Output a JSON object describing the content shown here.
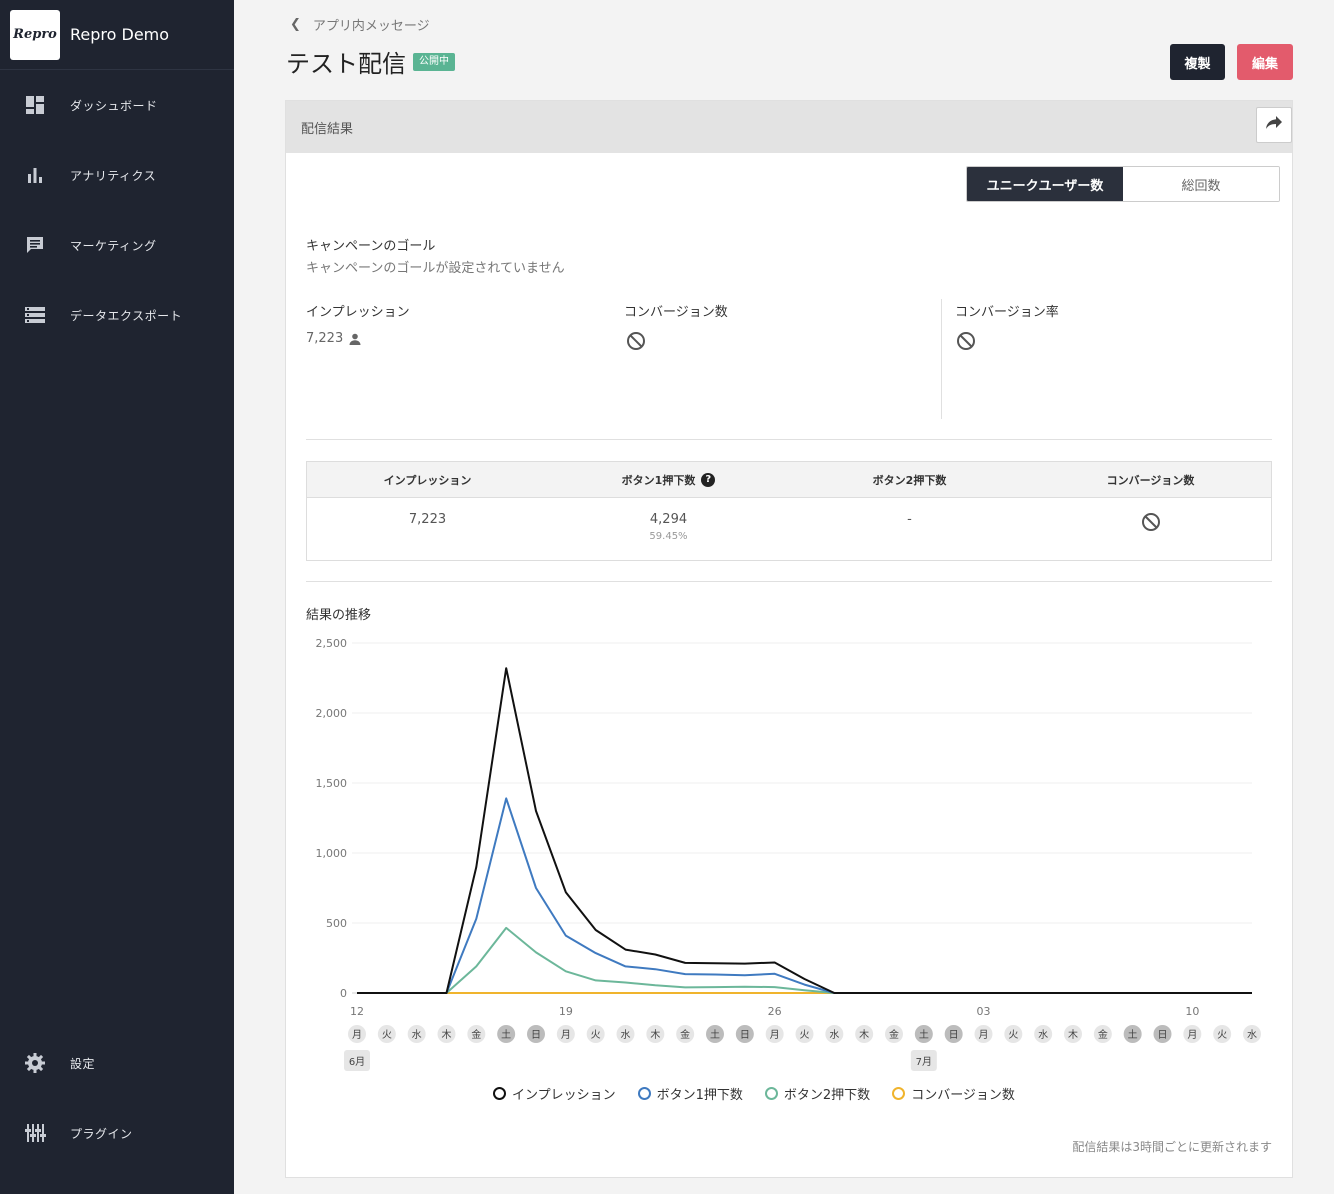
{
  "brand": {
    "logo_text": "Repro",
    "name": "Repro Demo"
  },
  "sidebar": {
    "items": [
      {
        "label": "ダッシュボード",
        "icon": "dashboard-icon"
      },
      {
        "label": "アナリティクス",
        "icon": "bar-chart-icon"
      },
      {
        "label": "マーケティング",
        "icon": "message-icon"
      },
      {
        "label": "データエクスポート",
        "icon": "storage-icon"
      }
    ],
    "bottom_items": [
      {
        "label": "設定",
        "icon": "gear-icon"
      },
      {
        "label": "プラグイン",
        "icon": "plugin-icon"
      }
    ]
  },
  "header": {
    "breadcrumb": "アプリ内メッセージ",
    "title": "テスト配信",
    "status": "公開中",
    "duplicate_label": "複製",
    "edit_label": "編集"
  },
  "card": {
    "title": "配信結果",
    "toggle": {
      "active": "ユニークユーザー数",
      "inactive": "総回数"
    },
    "goal_title": "キャンペーンのゴール",
    "goal_sub": "キャンペーンのゴールが設定されていません",
    "metrics": {
      "impression_label": "インプレッション",
      "impression_value": "7,223",
      "conversion_label": "コンバージョン数",
      "conversion_rate_label": "コンバージョン率"
    },
    "table": {
      "headers": [
        "インプレッション",
        "ボタン1押下数",
        "ボタン2押下数",
        "コンバージョン数"
      ],
      "help_mark": "?",
      "values": [
        "7,223",
        "4,294",
        "-"
      ],
      "button1_rate": "59.45%"
    },
    "chart_title": "結果の推移",
    "update_note": "配信結果は3時間ごとに更新されます"
  },
  "colors": {
    "sidebar_bg": "#1f2430",
    "badge": "#5ab493",
    "edit_button": "#e35b6c",
    "series_impression": "#111111",
    "series_button1": "#3f7ac0",
    "series_button2": "#6cb79a",
    "series_conversion": "#f0b42d"
  },
  "chart_data": {
    "type": "line",
    "x": [
      "06-12",
      "06-13",
      "06-14",
      "06-15",
      "06-16",
      "06-17",
      "06-18",
      "06-19",
      "06-20",
      "06-21",
      "06-22",
      "06-23",
      "06-24",
      "06-25",
      "06-26",
      "06-27",
      "06-28",
      "06-29",
      "06-30",
      "07-01",
      "07-02",
      "07-03",
      "07-04",
      "07-05",
      "07-06",
      "07-07",
      "07-08",
      "07-09",
      "07-10",
      "07-11",
      "07-12"
    ],
    "series": [
      {
        "name": "インプレッション",
        "values": [
          0,
          0,
          0,
          0,
          900,
          2320,
          1300,
          720,
          450,
          310,
          275,
          215,
          212,
          210,
          218,
          100,
          0,
          0,
          0,
          0,
          0,
          0,
          0,
          0,
          0,
          0,
          0,
          0,
          0,
          0,
          0
        ]
      },
      {
        "name": "ボタン1押下数",
        "values": [
          0,
          0,
          0,
          0,
          530,
          1390,
          750,
          410,
          285,
          190,
          170,
          135,
          132,
          127,
          137,
          60,
          0,
          0,
          0,
          0,
          0,
          0,
          0,
          0,
          0,
          0,
          0,
          0,
          0,
          0,
          0
        ]
      },
      {
        "name": "ボタン2押下数",
        "values": [
          0,
          0,
          0,
          0,
          190,
          465,
          290,
          155,
          90,
          75,
          55,
          40,
          42,
          45,
          42,
          20,
          0,
          0,
          0,
          0,
          0,
          0,
          0,
          0,
          0,
          0,
          0,
          0,
          0,
          0,
          0
        ]
      },
      {
        "name": "コンバージョン数",
        "values": [
          0,
          0,
          0,
          0,
          0,
          0,
          0,
          0,
          0,
          0,
          0,
          0,
          0,
          0,
          0,
          0,
          0,
          0,
          0,
          0,
          0,
          0,
          0,
          0,
          0,
          0,
          0,
          0,
          0,
          0,
          0
        ]
      }
    ],
    "ylim": [
      0,
      2500
    ],
    "y_ticks": [
      "0",
      "500",
      "1,000",
      "1,500",
      "2,000",
      "2,500"
    ],
    "x_date_labels": [
      {
        "index": 0,
        "label": "12"
      },
      {
        "index": 7,
        "label": "19"
      },
      {
        "index": 14,
        "label": "26"
      },
      {
        "index": 21,
        "label": "03"
      },
      {
        "index": 28,
        "label": "10"
      }
    ],
    "weekdays": [
      "月",
      "火",
      "水",
      "木",
      "金",
      "土",
      "日",
      "月",
      "火",
      "水",
      "木",
      "金",
      "土",
      "日",
      "月",
      "火",
      "水",
      "木",
      "金",
      "土",
      "日",
      "月",
      "火",
      "水",
      "木",
      "金",
      "土",
      "日",
      "月",
      "火",
      "水"
    ],
    "month_labels": [
      {
        "index": 0,
        "label": "6月"
      },
      {
        "index": 19,
        "label": "7月"
      }
    ],
    "grid": true,
    "legend": "bottom"
  }
}
